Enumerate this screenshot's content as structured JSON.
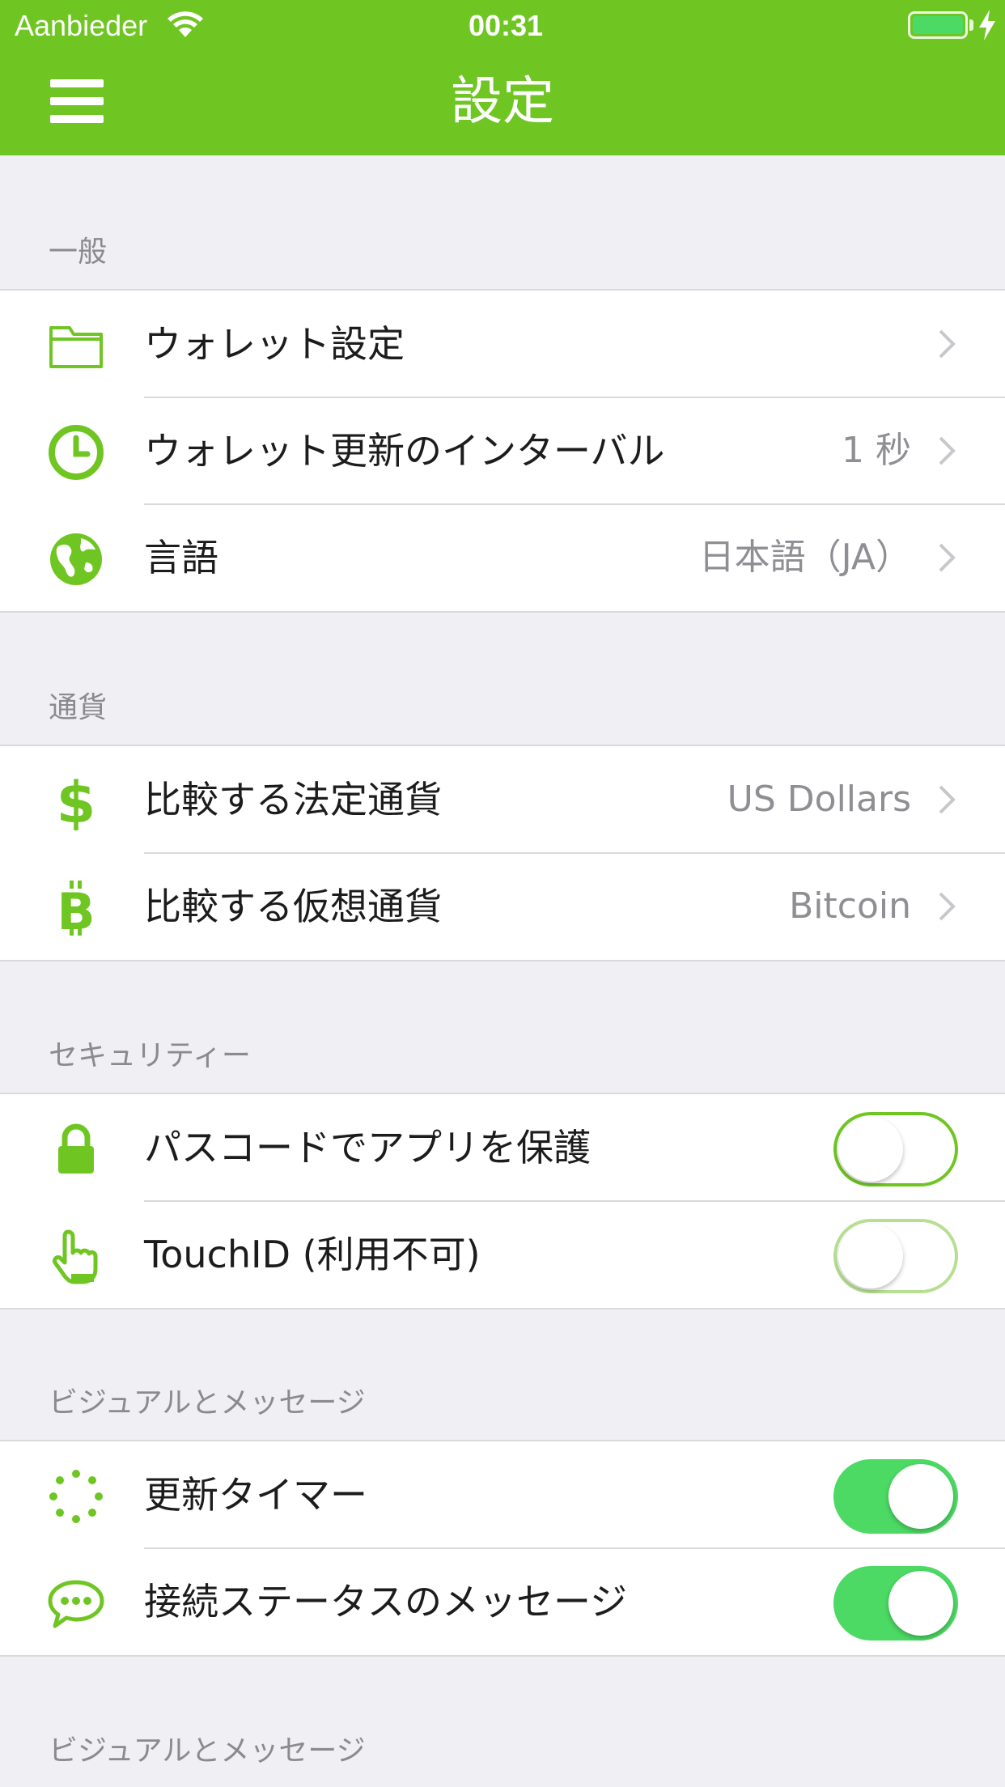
{
  "status_bar": {
    "carrier": "Aanbieder",
    "time": "00:31"
  },
  "header": {
    "title": "設定"
  },
  "sections": {
    "general": {
      "label": "一般",
      "rows": [
        {
          "label": "ウォレット設定",
          "value": "",
          "icon": "folder-icon"
        },
        {
          "label": "ウォレット更新のインターバル",
          "value": "1 秒",
          "icon": "clock-icon"
        },
        {
          "label": "言語",
          "value": "日本語（JA）",
          "icon": "globe-icon"
        }
      ]
    },
    "currency": {
      "label": "通貨",
      "rows": [
        {
          "label": "比較する法定通貨",
          "value": "US Dollars",
          "icon": "dollar-icon"
        },
        {
          "label": "比較する仮想通貨",
          "value": "Bitcoin",
          "icon": "bitcoin-icon"
        }
      ]
    },
    "security": {
      "label": "セキュリティー",
      "rows": [
        {
          "label": "パスコードでアプリを保護",
          "toggle": "off",
          "icon": "lock-icon"
        },
        {
          "label": "TouchID (利用不可)",
          "toggle": "off-disabled",
          "icon": "hand-pointer-icon"
        }
      ]
    },
    "visual": {
      "label": "ビジュアルとメッセージ",
      "rows": [
        {
          "label": "更新タイマー",
          "toggle": "on",
          "icon": "spinner-icon"
        },
        {
          "label": "接続ステータスのメッセージ",
          "toggle": "on",
          "icon": "chat-bubble-icon"
        }
      ]
    },
    "visual_repeat": {
      "label": "ビジュアルとメッセージ"
    }
  },
  "colors": {
    "accent": "#6fc623",
    "toggle_on": "#4cd964",
    "background": "#efeff4",
    "secondary_text": "#8e8e93"
  }
}
